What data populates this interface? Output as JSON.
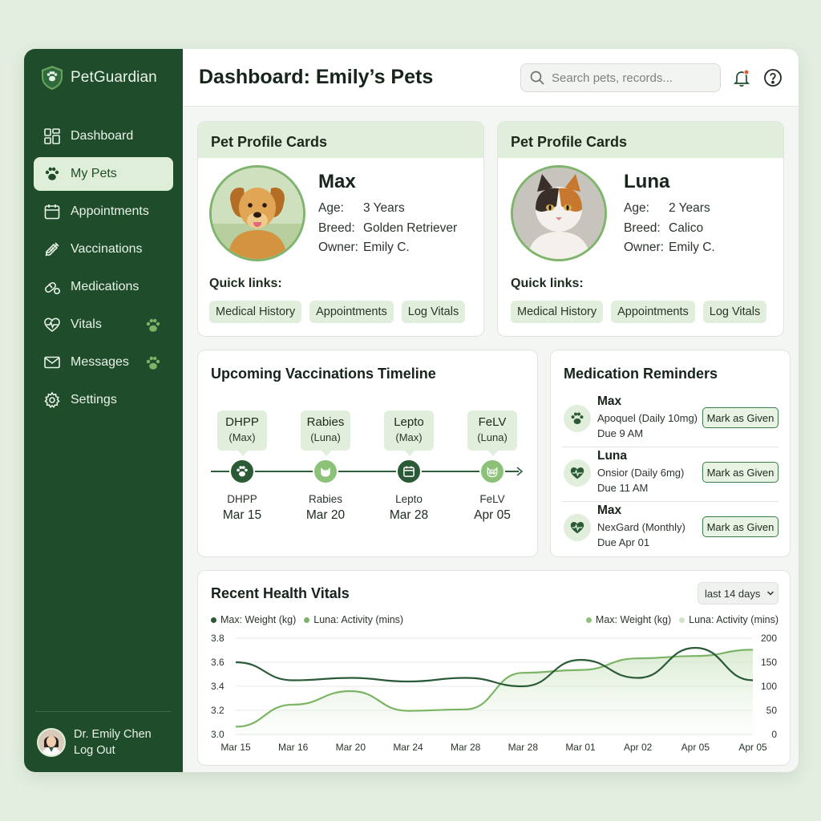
{
  "app": {
    "brand": "PetGuardian",
    "page_title": "Dashboard: Emily’s Pets"
  },
  "search": {
    "placeholder": "Search pets, records..."
  },
  "sidebar": {
    "items": [
      {
        "label": "Dashboard",
        "icon": "grid-icon",
        "active": false
      },
      {
        "label": "My Pets",
        "icon": "paw-icon",
        "active": true
      },
      {
        "label": "Appointments",
        "icon": "calendar-icon",
        "active": false
      },
      {
        "label": "Vaccinations",
        "icon": "syringe-icon",
        "active": false
      },
      {
        "label": "Medications",
        "icon": "pill-icon",
        "active": false
      },
      {
        "label": "Vitals",
        "icon": "heart-pulse-icon",
        "active": false
      },
      {
        "label": "Messages",
        "icon": "mail-icon",
        "active": false
      },
      {
        "label": "Settings",
        "icon": "gear-icon",
        "active": false
      }
    ],
    "user": {
      "name": "Dr. Emily Chen",
      "logout": "Log Out"
    }
  },
  "pets": [
    {
      "header": "Pet Profile Cards",
      "name": "Max",
      "age_label": "Age:",
      "age": "3 Years",
      "breed_label": "Breed:",
      "breed": "Golden Retriever",
      "owner_label": "Owner:",
      "owner": "Emily C.",
      "quick_links_label": "Quick links:",
      "links": [
        "Medical History",
        "Appointments",
        "Log Vitals"
      ]
    },
    {
      "header": "Pet Profile Cards",
      "name": "Luna",
      "age_label": "Age:",
      "age": "2 Years",
      "breed_label": "Breed:",
      "breed": "Calico",
      "owner_label": "Owner:",
      "owner": "Emily C.",
      "quick_links_label": "Quick links:",
      "links": [
        "Medical History",
        "Appointments",
        "Log Vitals"
      ]
    }
  ],
  "vaccinations": {
    "title": "Upcoming Vaccinations Timeline",
    "events": [
      {
        "vaccine": "DHPP",
        "pet": "(Max)",
        "label": "DHPP",
        "date": "Mar 15",
        "icon": "paw-icon"
      },
      {
        "vaccine": "Rabies",
        "pet": "(Luna)",
        "label": "Rabies",
        "date": "Mar 20",
        "icon": "cat-icon"
      },
      {
        "vaccine": "Lepto",
        "pet": "(Max)",
        "label": "Lepto",
        "date": "Mar 28",
        "icon": "calendar-icon"
      },
      {
        "vaccine": "FeLV",
        "pet": "(Luna)",
        "label": "FeLV",
        "date": "Apr 05",
        "icon": "cat-face-icon"
      }
    ]
  },
  "medications": {
    "title": "Medication Reminders",
    "button_label": "Mark as Given",
    "items": [
      {
        "pet": "Max",
        "drug": "Apoquel (Daily 10mg)",
        "due": "Due 9 AM",
        "icon": "paw-icon"
      },
      {
        "pet": "Luna",
        "drug": "Onsior (Daily 6mg)",
        "due": "Due 11 AM",
        "icon": "heart-pulse-icon"
      },
      {
        "pet": "Max",
        "drug": "NexGard (Monthly)",
        "due": "Due Apr 01",
        "icon": "heart-pulse-icon"
      }
    ]
  },
  "vitals": {
    "title": "Recent Health Vitals",
    "range": "last 14 days",
    "legend_left": [
      "Max: Weight (kg)",
      "Luna: Activity (mins)"
    ],
    "legend_right": [
      "Max: Weight (kg)",
      "Luna: Activity (mins)"
    ]
  },
  "chart_data": {
    "type": "line",
    "title": "Recent Health Vitals",
    "categories": [
      "Mar 15",
      "Mar 16",
      "Mar 20",
      "Mar 24",
      "Mar 28",
      "Mar 28",
      "Mar 01",
      "Apr 02",
      "Apr 05",
      "Apr 05"
    ],
    "y_left": {
      "ylim": [
        3.0,
        3.8
      ],
      "ticks": [
        "3.8",
        "3.6",
        "3.4",
        "3.2",
        "3.0"
      ]
    },
    "y_right": {
      "ylim": [
        0,
        200
      ],
      "ticks": [
        "200",
        "150",
        "100",
        "50",
        "0"
      ]
    },
    "grid": true,
    "legend_placement": "top",
    "series": [
      {
        "name": "Max: Weight (kg)",
        "axis": "left",
        "color": "#2a5a36",
        "values": [
          3.6,
          3.45,
          3.47,
          3.44,
          3.47,
          3.4,
          3.62,
          3.47,
          3.72,
          3.45
        ]
      },
      {
        "name": "Luna: Activity (mins)",
        "axis": "right",
        "color": "#7ab464",
        "values": [
          16,
          62,
          90,
          49,
          52,
          128,
          134,
          158,
          163,
          176
        ]
      }
    ]
  },
  "colors": {
    "sidebar": "#1f4d2c",
    "accent": "#7ab464",
    "dark": "#2a5a36",
    "chip": "#e0eedb"
  }
}
